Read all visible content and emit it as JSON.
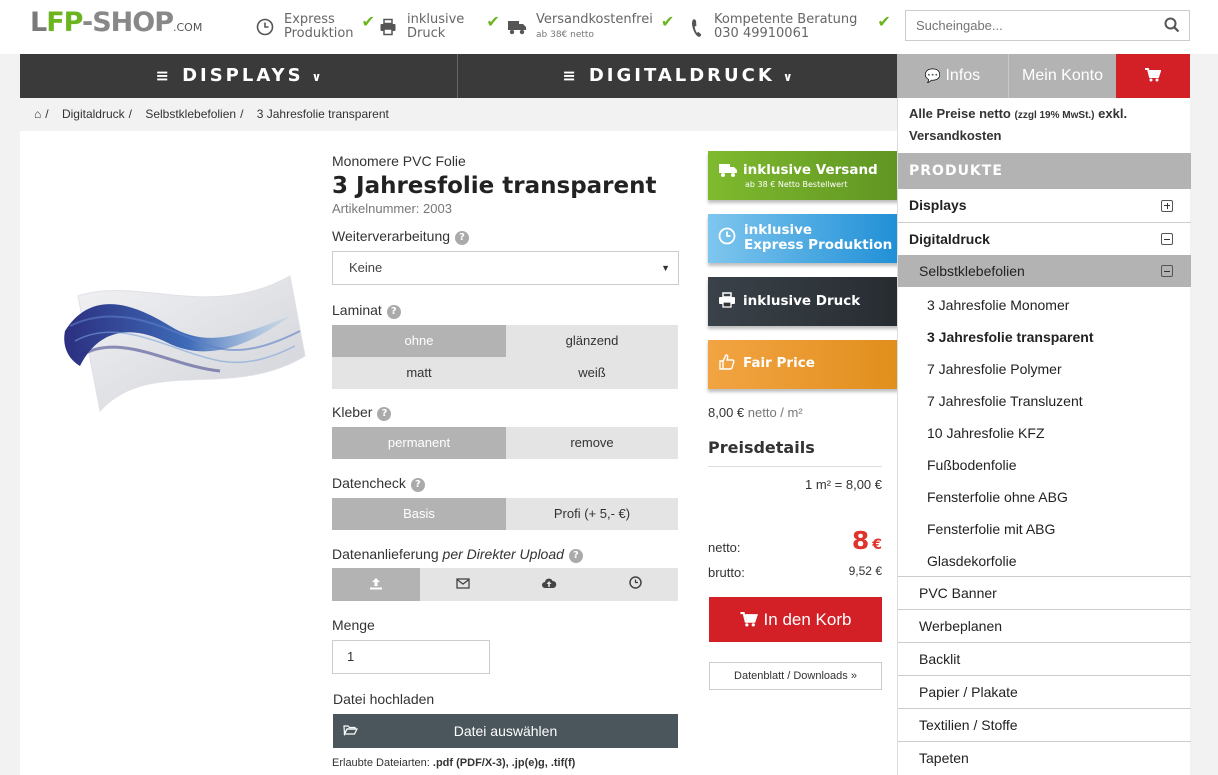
{
  "header": {
    "logo": {
      "part1": "L",
      "part2": "F",
      "part3": "P-SHOP",
      "domain": ".COM"
    },
    "features": [
      {
        "icon": "clock-icon",
        "line1": "Express",
        "line2": "Produktion",
        "small": ""
      },
      {
        "icon": "printer-icon",
        "line1": "inklusive",
        "line2": "Druck",
        "small": ""
      },
      {
        "icon": "truck-icon",
        "line1": "Versandkostenfrei",
        "line2": "",
        "small": "ab 38€ netto"
      },
      {
        "icon": "phone-icon",
        "line1": "Kompetente Beratung",
        "line2": "030 49910061",
        "small": ""
      }
    ],
    "search_placeholder": "Sucheingabe..."
  },
  "nav": {
    "items": [
      {
        "label": "DISPLAYS"
      },
      {
        "label": "DIGITALDRUCK"
      }
    ],
    "tabs": [
      {
        "label": "Infos"
      },
      {
        "label": "Mein Konto"
      }
    ]
  },
  "breadcrumb": [
    "Digitaldruck",
    "Selbstklebefolien",
    "3 Jahresfolie transparent"
  ],
  "product": {
    "category": "Monomere PVC Folie",
    "title": "3 Jahresfolie transparent",
    "article": "Artikelnummer: 2003",
    "weiterverarbeitung_label": "Weiterverarbeitung",
    "weiterverarbeitung_value": "Keine",
    "laminat_label": "Laminat",
    "laminat_options": [
      "ohne",
      "glänzend",
      "matt",
      "weiß"
    ],
    "kleber_label": "Kleber",
    "kleber_options": [
      "permanent",
      "remove"
    ],
    "datencheck_label": "Datencheck",
    "datencheck_options": [
      "Basis",
      "Profi (+ 5,- €)"
    ],
    "datenanlieferung_label": "Datenanlieferung",
    "datenanlieferung_mode": "per Direkter Upload",
    "menge_label": "Menge",
    "menge_value": "1",
    "datei_label": "Datei hochladen",
    "datei_button": "Datei auswählen",
    "allowed_prefix": "Erlaubte Dateiarten:",
    "allowed_types": ".pdf (PDF/X-3), .jp(e)g, .tif(f)"
  },
  "ribbons": [
    {
      "title": "inklusive Versand",
      "sub": "ab 38 € Netto Bestellwert",
      "color": "#6ea52a"
    },
    {
      "title": "inklusive",
      "title2": "Express Produktion",
      "color": "#2f9ad8"
    },
    {
      "title": "inklusive Druck",
      "color": "#333a40"
    },
    {
      "title": "Fair Price",
      "color": "#e8941f"
    }
  ],
  "pricing": {
    "per_m2_value": "8,00 €",
    "per_m2_unit": "netto / m²",
    "details_label": "Preisdetails",
    "m2_line": "1 m² = 8,00 €",
    "netto_label": "netto:",
    "netto_value": "8",
    "currency": "€",
    "brutto_label": "brutto:",
    "brutto_value": "9,52 €",
    "cart_button": "In den Korb",
    "download_button": "Datenblatt / Downloads"
  },
  "sidebar": {
    "price_note_bold": "Alle Preise netto",
    "price_note_small": "(zzgl 19% MwSt.)",
    "price_note_rest": "exkl. Versandkosten",
    "head": "PRODUKTE",
    "top_items": [
      "Displays",
      "Digitaldruck"
    ],
    "sub_active": "Selbstklebefolien",
    "sub_items": [
      "3 Jahresfolie Monomer",
      "3 Jahresfolie transparent",
      "7 Jahresfolie Polymer",
      "7 Jahresfolie Transluzent",
      "10 Jahresfolie KFZ",
      "Fußbodenfolie",
      "Fensterfolie ohne ABG",
      "Fensterfolie mit ABG",
      "Glasdekorfolie"
    ],
    "other_items": [
      "PVC Banner",
      "Werbeplanen",
      "Backlit",
      "Papier / Plakate",
      "Textilien / Stoffe",
      "Tapeten"
    ]
  },
  "colors": {
    "accent_red": "#d31f26",
    "nav_dark": "#3a3a3a",
    "brand_green": "#6cb520"
  }
}
